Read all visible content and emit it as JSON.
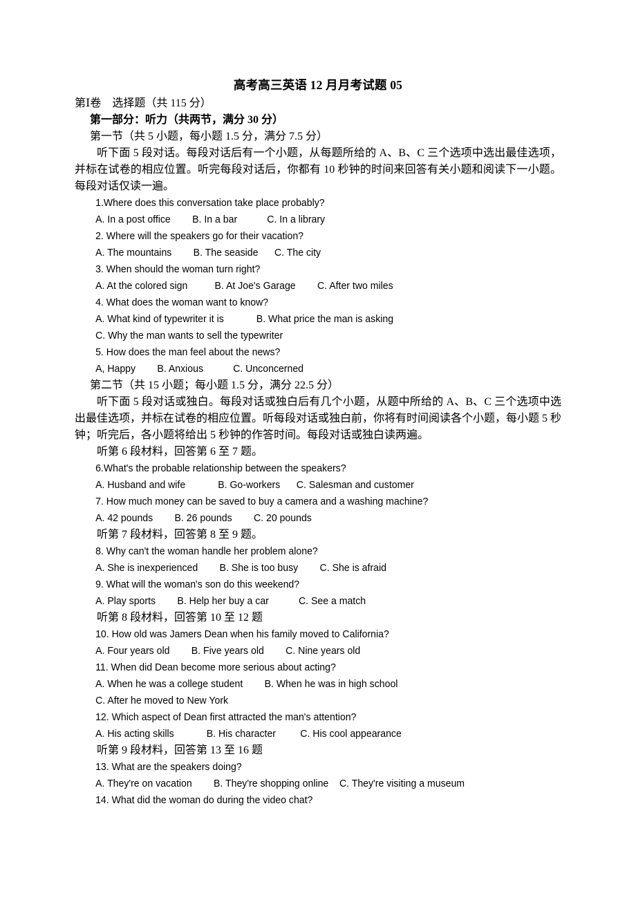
{
  "document": {
    "title": "高考高三英语 12 月月考试题 05",
    "paper_section": "第Ⅰ卷　选择题（共 115 分）",
    "part_one_heading": "第一部分：听力（共两节，满分 30 分）",
    "section_one_heading": "第一节（共 5 小题，每小题 1.5 分，满分 7.5 分）",
    "section_one_instructions": "听下面 5 段对话。每段对话后有一个小题，从每题所给的 A、B、C 三个选项中选出最佳选项，并标在试卷的相应位置。听完每段对话后，你都有 10 秒钟的时间来回答有关小题和阅读下一小题。每段对话仅读一遍。",
    "section_two_heading": "第二节（共 15 小题；每小题 1.5 分，满分 22.5 分）",
    "section_two_instructions": "听下面 5 段对话或独白。每段对话或独白后有几个小题，从题中所给的 A、B、C 三个选项中选出最佳选项，并标在试卷的相应位置。听每段对话或独白前，你将有时间阅读各个小题，每小题 5 秒钟；听完后，各小题将给出 5 秒钟的作答时间。每段对话或独白读两遍。",
    "material_6_label": "听第 6 段材料，回答第 6 至 7 题。",
    "material_7_label": "听第 7 段材料，回答第 8 至 9 题。",
    "material_8_label": "听第 8 段材料，回答第 10 至 12 题",
    "material_9_label": "听第 9 段材料，回答第 13 至 16 题"
  },
  "questions": [
    {
      "stem": "1.Where does this conversation take place probably?",
      "option_lines": [
        "A. In a post office        B. In a bar           C. In a library"
      ]
    },
    {
      "stem": "2. Where will the speakers go for their vacation?",
      "option_lines": [
        "A. The mountains        B. The seaside      C. The city"
      ]
    },
    {
      "stem": "3. When should the woman turn right?",
      "option_lines": [
        "A. At the colored sign          B. At Joe's Garage        C. After two miles"
      ]
    },
    {
      "stem": "4. What does the woman want to know?",
      "option_lines": [
        "A. What kind of typewriter it is            B. What price the man is asking",
        "C. Why the man wants to sell the typewriter"
      ]
    },
    {
      "stem": "5. How does the man feel about the news?",
      "option_lines": [
        "A, Happy        B. Anxious           C. Unconcerned"
      ]
    },
    {
      "stem": "6.What's the probable relationship between the speakers?",
      "option_lines": [
        "A. Husband and wife            B. Go-workers      C. Salesman and customer"
      ]
    },
    {
      "stem": "7. How much money can be saved to buy a camera and a washing machine?",
      "option_lines": [
        "A. 42 pounds        B. 26 pounds        C. 20 pounds"
      ]
    },
    {
      "stem": "8. Why can't the woman handle her problem alone?",
      "option_lines": [
        "A. She is inexperienced        B. She is too busy        C. She is afraid"
      ]
    },
    {
      "stem": "9. What will the woman's son do this weekend?",
      "option_lines": [
        "A. Play sports        B. Help her buy a car           C. See a match"
      ]
    },
    {
      "stem": "10. How old was Jamers Dean when his family moved to California?",
      "option_lines": [
        "A. Four years old        B. Five years old        C. Nine years old"
      ]
    },
    {
      "stem": "11. When did Dean become more serious about acting?",
      "option_lines": [
        "A. When he was a college student        B. When he was in high school",
        "C. After he moved to New York"
      ]
    },
    {
      "stem": "12. Which aspect of Dean first attracted the man's attention?",
      "option_lines": [
        "A. His acting skills            B. His character         C. His cool appearance"
      ]
    },
    {
      "stem": "13. What are the speakers doing?",
      "option_lines": [
        "A. They're on vacation        B. They're shopping online    C. They're visiting a museum"
      ]
    },
    {
      "stem": "14. What did the woman do during the video chat?",
      "option_lines": []
    }
  ]
}
